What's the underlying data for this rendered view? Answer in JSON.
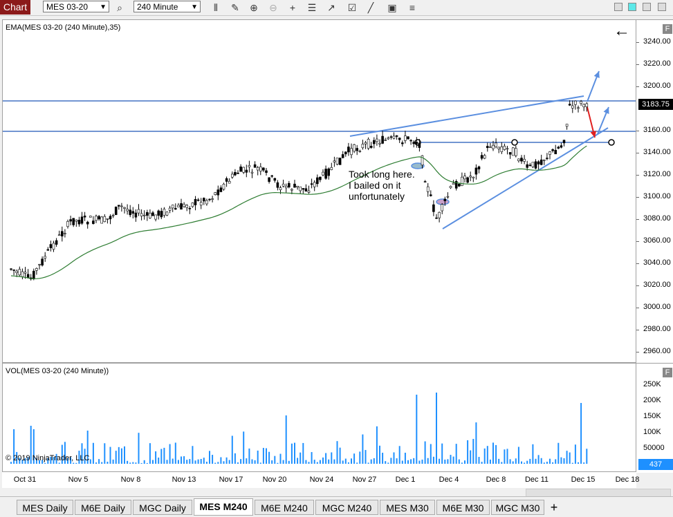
{
  "toolbar": {
    "chart_label": "Chart",
    "instrument": "MES 03-20",
    "interval": "240 Minute"
  },
  "price_panel": {
    "label": "EMA(MES 03-20 (240 Minute),35)",
    "current_price": "3183.75",
    "price_ticks": [
      "3240.00",
      "3220.00",
      "3200.00",
      "3160.00",
      "3140.00",
      "3120.00",
      "3100.00",
      "3080.00",
      "3060.00",
      "3040.00",
      "3020.00",
      "3000.00",
      "2980.00",
      "2960.00"
    ],
    "annotation": [
      "Took long here.",
      "I bailed on it",
      "unfortunately"
    ],
    "back_arrow": "←"
  },
  "volume_panel": {
    "label": "VOL(MES 03-20 (240 Minute))",
    "current_volume": "437",
    "volume_ticks": [
      "250K",
      "200K",
      "150K",
      "100K",
      "50000"
    ],
    "copyright": "© 2019 NinjaTrader, LLC"
  },
  "x_axis": {
    "labels": [
      "Oct 31",
      "Nov 5",
      "Nov 8",
      "Nov 13",
      "Nov 17",
      "Nov 20",
      "Nov 24",
      "Nov 27",
      "Dec 1",
      "Dec 4",
      "Dec 8",
      "Dec 11",
      "Dec 15",
      "Dec 18"
    ]
  },
  "tabs": [
    {
      "label": "MES  Daily",
      "active": false
    },
    {
      "label": "M6E  Daily",
      "active": false
    },
    {
      "label": "MGC  Daily",
      "active": false
    },
    {
      "label": "MES  M240",
      "active": true
    },
    {
      "label": "M6E  M240",
      "active": false
    },
    {
      "label": "MGC  M240",
      "active": false
    },
    {
      "label": "MES  M30",
      "active": false
    },
    {
      "label": "M6E  M30",
      "active": false
    },
    {
      "label": "MGC  M30",
      "active": false
    }
  ],
  "add_tab": "+",
  "panel_toggle": "F",
  "colors": {
    "bull_candle": "#ffffff",
    "bear_candle": "#000000",
    "ema": "#2e7d32",
    "hline": "#4472c4",
    "trend": "#5b8fe0",
    "volume": "#1e90ff",
    "arrow_down": "#e02020"
  }
}
